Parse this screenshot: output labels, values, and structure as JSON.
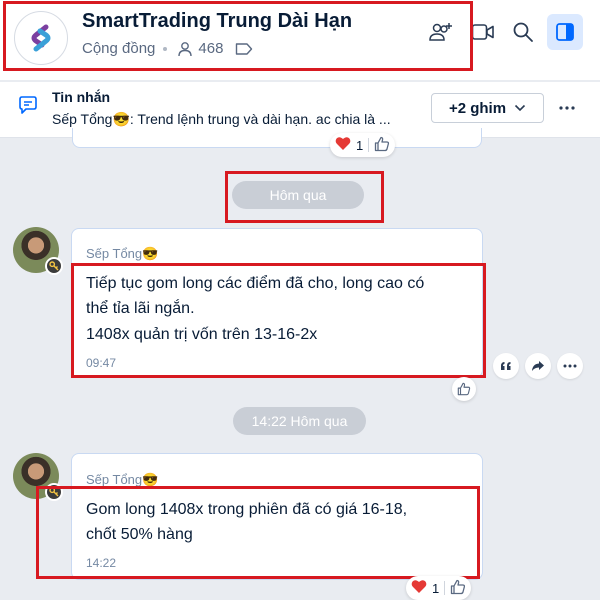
{
  "header": {
    "title": "SmartTrading Trung Dài Hạn",
    "community_label": "Cộng đồng",
    "member_count": "468"
  },
  "pinned": {
    "title": "Tin nhắn",
    "text": "Sếp Tổng😎: Trend lệnh trung và dài hạn. ac chia là ...",
    "pin_button": "+2 ghim"
  },
  "previous_message": {
    "reaction_count": "1"
  },
  "date_separator_1": "Hôm qua",
  "date_separator_2": "14:22 Hôm qua",
  "messages": [
    {
      "sender": "Sếp Tổng😎",
      "lines": [
        "Tiếp tục gom long các điểm đã cho, long cao có",
        "thể tỉa lãi ngắn.",
        "1408x quản trị vốn trên 13-16-2x"
      ],
      "time": "09:47"
    },
    {
      "sender": "Sếp Tổng😎",
      "lines": [
        "Gom long 1408x trong phiên đã có giá 16-18,",
        "chốt 50% hàng"
      ],
      "time": "14:22",
      "reaction_count": "1"
    }
  ],
  "colors": {
    "accent": "#0068ff",
    "highlight_box": "#d71920",
    "heart": "#e53935"
  }
}
